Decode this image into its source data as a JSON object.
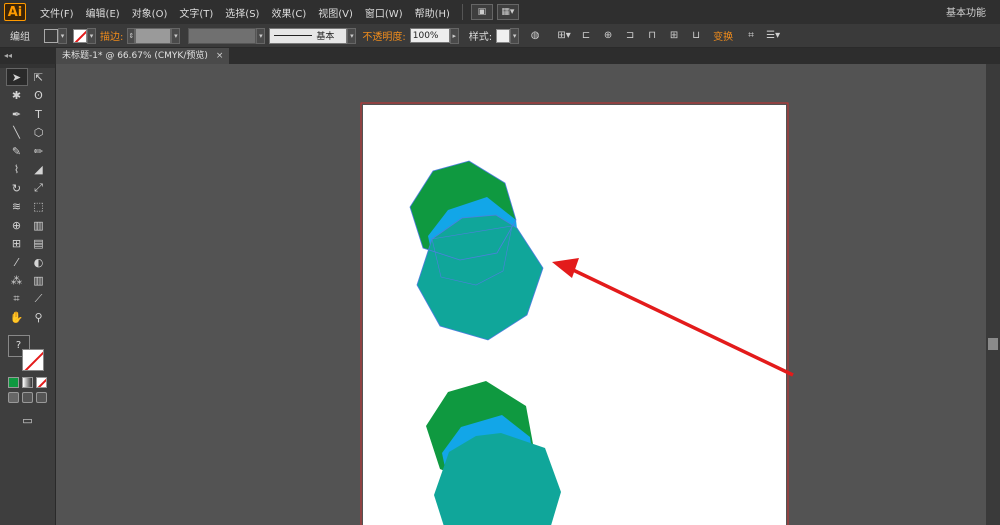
{
  "app": {
    "logo": "Ai",
    "workspace": "基本功能"
  },
  "menu": [
    "文件(F)",
    "编辑(E)",
    "对象(O)",
    "文字(T)",
    "选择(S)",
    "效果(C)",
    "视图(V)",
    "窗口(W)",
    "帮助(H)"
  ],
  "control": {
    "selection_label": "编组",
    "stroke_label": "描边:",
    "stroke_profile": "基本",
    "opacity_label": "不透明度:",
    "opacity_value": "100%",
    "style_label": "样式:",
    "transform_label": "变换"
  },
  "document": {
    "collapse": "◂◂",
    "tab_title": "未标题-1* @ 66.67% (CMYK/预览)",
    "tab_close": "×"
  },
  "colors": {
    "green": "#0f9940",
    "blue": "#12a6e8",
    "teal": "#10a69a",
    "arrow": "#e31b1b",
    "artboard_border": "#c83232"
  },
  "tools": [
    [
      "selection-tool-icon",
      "direct-selection-tool-icon"
    ],
    [
      "magic-wand-icon",
      "lasso-icon"
    ],
    [
      "pen-tool-icon",
      "type-tool-icon"
    ],
    [
      "line-tool-icon",
      "polygon-tool-icon"
    ],
    [
      "paintbrush-icon",
      "pencil-icon"
    ],
    [
      "blob-brush-icon",
      "eraser-icon"
    ],
    [
      "rotate-tool-icon",
      "scale-tool-icon"
    ],
    [
      "warp-tool-icon",
      "free-transform-icon"
    ],
    [
      "shape-builder-icon",
      "perspective-grid-icon"
    ],
    [
      "mesh-tool-icon",
      "gradient-tool-icon"
    ],
    [
      "eyedropper-icon",
      "blend-tool-icon"
    ],
    [
      "symbol-sprayer-icon",
      "column-graph-icon"
    ],
    [
      "artboard-tool-icon",
      "slice-tool-icon"
    ],
    [
      "hand-tool-icon",
      "zoom-tool-icon"
    ]
  ]
}
